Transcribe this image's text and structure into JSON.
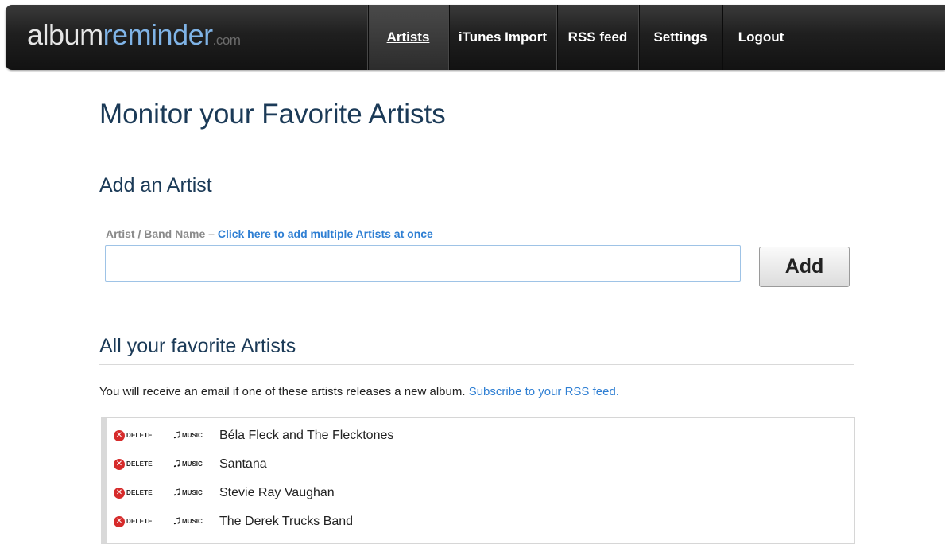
{
  "header": {
    "logo": {
      "part1": "album",
      "part2": "reminder",
      "part3": ".com"
    },
    "nav": [
      {
        "label": "Artists",
        "active": true
      },
      {
        "label": "iTunes Import",
        "active": false
      },
      {
        "label": "RSS feed",
        "active": false
      },
      {
        "label": "Settings",
        "active": false
      },
      {
        "label": "Logout",
        "active": false
      }
    ]
  },
  "main": {
    "title": "Monitor your Favorite Artists",
    "add_section": {
      "title": "Add an Artist",
      "field_label": "Artist / Band Name –",
      "multi_link": "Click here to add multiple Artists at once",
      "input_value": "",
      "add_button": "Add"
    },
    "favorites_section": {
      "title": "All your favorite Artists",
      "info_text": "You will receive an email if one of these artists releases a new album.",
      "rss_link": "Subscribe to your RSS feed.",
      "row_actions": {
        "delete_label": "DELETE",
        "music_label": "MUSIC"
      },
      "artists": [
        "Béla Fleck and The Flecktones",
        "Santana",
        "Stevie Ray Vaughan",
        "The Derek Trucks Band"
      ]
    }
  },
  "icons": {
    "delete": "close-circle-icon",
    "music": "music-note-icon"
  },
  "colors": {
    "heading": "#1b3a57",
    "link": "#2f7fd3",
    "logo_accent": "#7fb3e6",
    "delete_red": "#d62b2b"
  }
}
